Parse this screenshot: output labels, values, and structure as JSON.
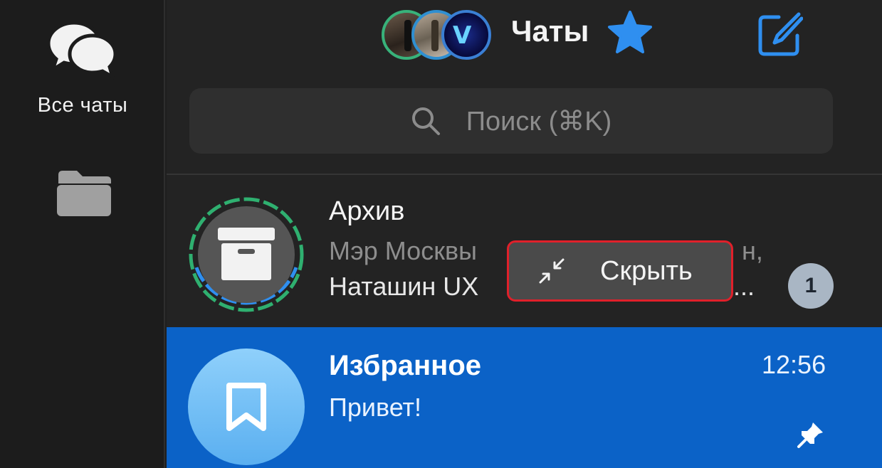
{
  "sidebar": {
    "folders": [
      {
        "label": "Все чаты",
        "icon": "chat-bubbles-icon"
      },
      {
        "label": "",
        "icon": "folder-icon"
      }
    ]
  },
  "header": {
    "title": "Чаты",
    "stories_count": 3,
    "star_icon": "star-icon",
    "compose_icon": "compose-icon"
  },
  "search": {
    "placeholder": "Поиск (⌘K)"
  },
  "chats": [
    {
      "title": "Архив",
      "line1": "Мэр Москвы",
      "line1_end": "н,",
      "line2": "Наташин UX",
      "line2_end": "...",
      "unread": "1",
      "icon": "archive-box-icon"
    },
    {
      "title": "Избранное",
      "message": "Привет!",
      "time": "12:56",
      "icon": "bookmark-icon",
      "pinned": true
    }
  ],
  "context_button": {
    "label": "Скрыть",
    "icon": "collapse-arrows-icon"
  },
  "colors": {
    "accent": "#2f8ff0",
    "selected_row": "#0b62c7",
    "highlight_border": "#e0202a"
  }
}
